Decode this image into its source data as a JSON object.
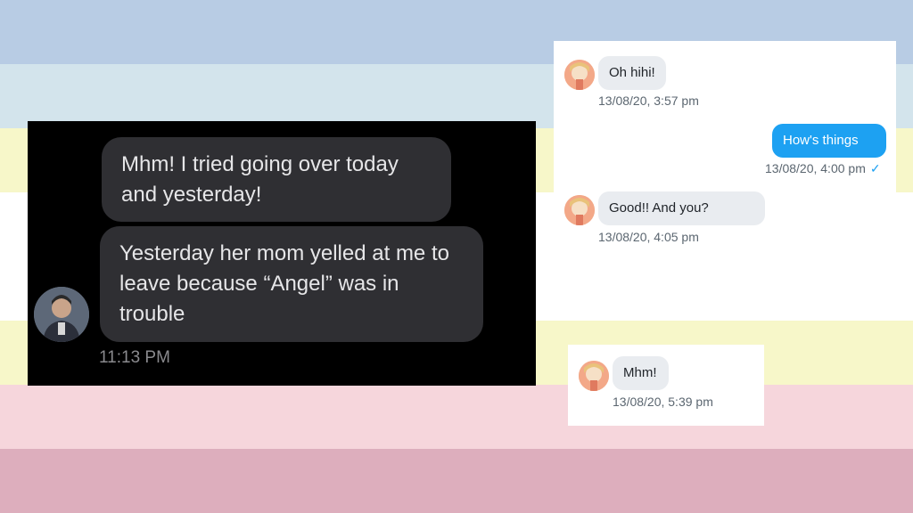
{
  "background_stripes": [
    "#b8cce4",
    "#d3e4ec",
    "#f7f7c9",
    "#ffffff",
    "#f7f7c9",
    "#f6d6dc",
    "#ddaebd"
  ],
  "dark_chat": {
    "messages": [
      {
        "text": "Mhm! I tried going over today and yesterday!"
      },
      {
        "text": "Yesterday her mom yelled at me to leave because “Angel” was in trouble"
      }
    ],
    "timestamp": "11:13 PM"
  },
  "light_chat": {
    "accent": "#1da1f2",
    "messages": [
      {
        "text": "Oh hihi!",
        "time": "13/08/20, 3:57 pm",
        "direction": "received"
      },
      {
        "text": "How's things",
        "time": "13/08/20, 4:00 pm",
        "direction": "sent",
        "status_icon": "check-icon"
      },
      {
        "text": "Good!! And you?",
        "time": "13/08/20, 4:05 pm",
        "direction": "received"
      }
    ]
  },
  "light_chat_2": {
    "messages": [
      {
        "text": "Mhm!",
        "time": "13/08/20, 5:39 pm",
        "direction": "received"
      }
    ]
  }
}
